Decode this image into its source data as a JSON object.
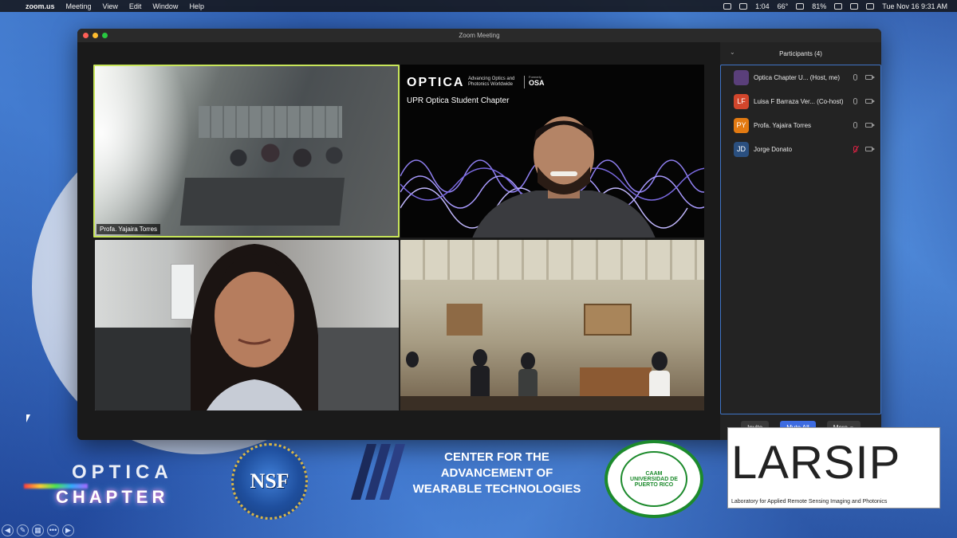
{
  "menubar": {
    "app": "zoom.us",
    "items": [
      "Meeting",
      "View",
      "Edit",
      "Window",
      "Help"
    ],
    "time_short": "1:04",
    "temperature": "66°",
    "battery": "81%",
    "datetime": "Tue Nov 16  9:31 AM"
  },
  "window": {
    "title": "Zoom Meeting"
  },
  "videos": {
    "tile1_name": "Profa. Yajaira Torres",
    "optica_logo": "OPTICA",
    "optica_tagline": "Advancing Optics and Photonics Worldwide",
    "optica_formerly": "Formerly",
    "optica_osa": "OSA",
    "optica_chapter": "UPR Optica Student Chapter"
  },
  "participants": {
    "header": "Participants (4)",
    "list": [
      {
        "initials": "",
        "name": "Optica Chapter U...   (Host, me)",
        "color": "#5a3f7a",
        "mic_muted": false
      },
      {
        "initials": "LF",
        "name": "Luisa F Barraza Ver... (Co-host)",
        "color": "#d2462c",
        "mic_muted": false
      },
      {
        "initials": "PY",
        "name": "Profa. Yajaira Torres",
        "color": "#e27a12",
        "mic_muted": false
      },
      {
        "initials": "JD",
        "name": "Jorge Donato",
        "color": "#2a4f7f",
        "mic_muted": true
      }
    ],
    "invite": "Invite",
    "mute_all": "Mute All",
    "more": "More"
  },
  "slide": {
    "optica_chapter_line1": "OPTICA",
    "optica_chapter_line2": "CHAPTER",
    "nsf": "NSF",
    "cawt": "CENTER FOR THE ADVANCEMENT OF WEARABLE TECHNOLOGIES",
    "uprm": "UNIVERSIDAD DE PUERTO RICO",
    "uprm_top": "CAAM",
    "larsip": "LARSIP",
    "larsip_sub": "Laboratory for Applied Remote Sensing Imaging and Photonics"
  }
}
